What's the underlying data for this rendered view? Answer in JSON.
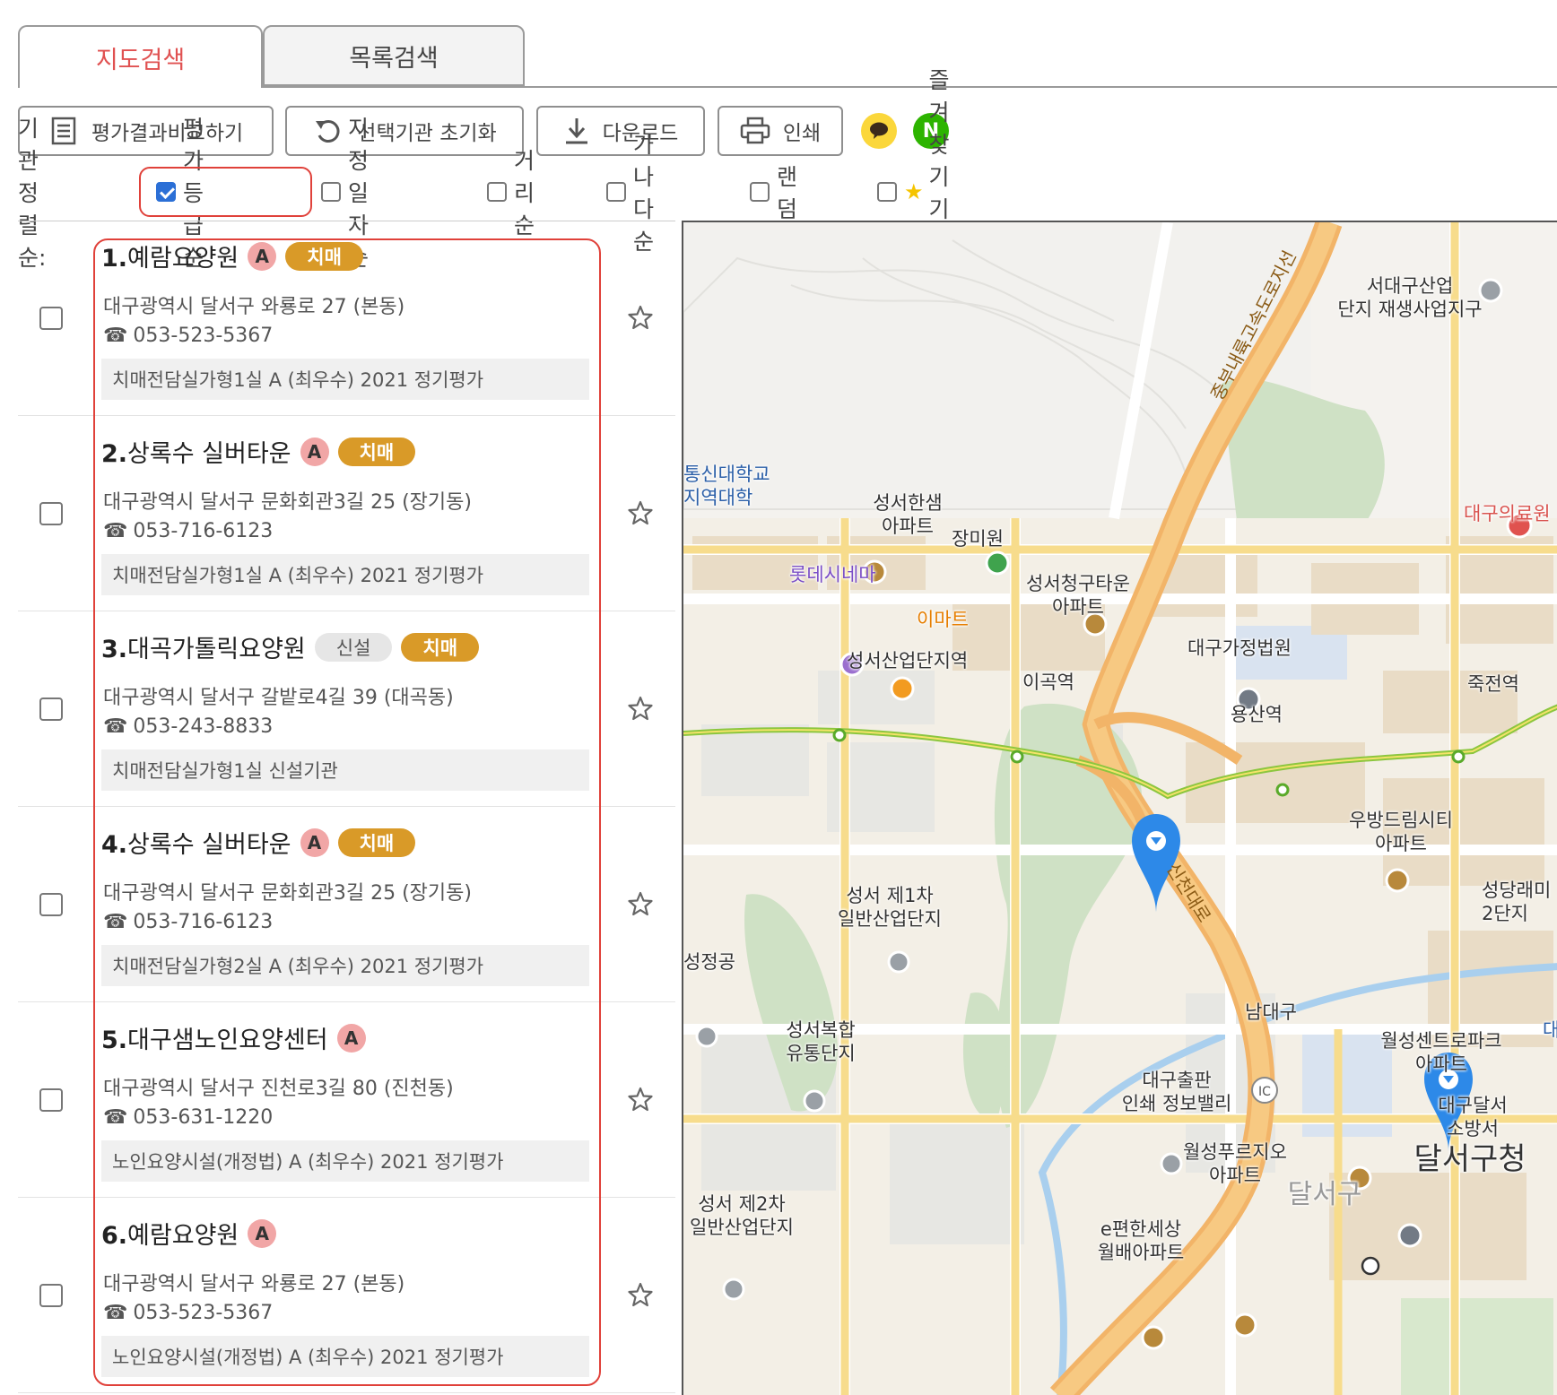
{
  "tabs": [
    {
      "label": "지도검색",
      "active": true
    },
    {
      "label": "목록검색",
      "active": false
    }
  ],
  "toolbar": {
    "compare": "평가결과비교하기",
    "reset": "선택기관 초기화",
    "download": "다운로드",
    "print": "인쇄",
    "share_kakao_icon": "kakao-talk-icon",
    "share_naver_icon": "naver-icon",
    "naver_letter": "N"
  },
  "sort": {
    "label": "기관정렬순:",
    "options": [
      {
        "label": "평가등급순",
        "checked": true
      },
      {
        "label": "지정일자순",
        "checked": false
      },
      {
        "label": "거리순",
        "checked": false
      },
      {
        "label": "가나다순",
        "checked": false
      },
      {
        "label": "랜덤",
        "checked": false
      }
    ],
    "favorites": "즐겨찾기 기관 보기"
  },
  "list": [
    {
      "num": "1.",
      "name": "예람요양원",
      "grade": "A",
      "new_badge": null,
      "dementia_badge": "치매",
      "address": "대구광역시 달서구 와룡로 27 (본동)",
      "phone": "053-523-5367",
      "eval": "치매전담실가형1실 A (최우수) 2021 정기평가"
    },
    {
      "num": "2.",
      "name": "상록수 실버타운",
      "grade": "A",
      "new_badge": null,
      "dementia_badge": "치매",
      "address": "대구광역시 달서구 문화회관3길 25 (장기동)",
      "phone": "053-716-6123",
      "eval": "치매전담실가형1실 A (최우수) 2021 정기평가"
    },
    {
      "num": "3.",
      "name": "대곡가톨릭요양원",
      "grade": null,
      "new_badge": "신설",
      "dementia_badge": "치매",
      "address": "대구광역시 달서구 갈밭로4길 39 (대곡동)",
      "phone": "053-243-8833",
      "eval": "치매전담실가형1실 신설기관"
    },
    {
      "num": "4.",
      "name": "상록수 실버타운",
      "grade": "A",
      "new_badge": null,
      "dementia_badge": "치매",
      "address": "대구광역시 달서구 문화회관3길 25 (장기동)",
      "phone": "053-716-6123",
      "eval": "치매전담실가형2실 A (최우수) 2021 정기평가"
    },
    {
      "num": "5.",
      "name": "대구샘노인요양센터",
      "grade": "A",
      "new_badge": null,
      "dementia_badge": null,
      "address": "대구광역시 달서구 진천로3길 80 (진천동)",
      "phone": "053-631-1220",
      "eval": "노인요양시설(개정법) A (최우수) 2021 정기평가"
    },
    {
      "num": "6.",
      "name": "예람요양원",
      "grade": "A",
      "new_badge": null,
      "dementia_badge": null,
      "address": "대구광역시 달서구 와룡로 27 (본동)",
      "phone": "053-523-5367",
      "eval": "노인요양시설(개정법) A (최우수) 2021 정기평가"
    }
  ],
  "map": {
    "road_label_1": "중부내륙고속도로지선",
    "road_label_2": "신천대로",
    "ic_label": "IC",
    "labels": [
      {
        "text": "서대구산업\n단지 재생사업지구"
      },
      {
        "text": "통신대학교\n지역대학"
      },
      {
        "text": "대구의료원"
      },
      {
        "text": "성서한샘\n아파트"
      },
      {
        "text": "장미원"
      },
      {
        "text": "성서청구타운\n아파트"
      },
      {
        "text": "롯데시네마"
      },
      {
        "text": "이마트"
      },
      {
        "text": "대구가정법원"
      },
      {
        "text": "성서산업단지역"
      },
      {
        "text": "이곡역"
      },
      {
        "text": "용산역"
      },
      {
        "text": "죽전역"
      },
      {
        "text": "우방드림시티\n아파트"
      },
      {
        "text": "성서 제1차\n일반산업단지"
      },
      {
        "text": "성당래미\n2단지"
      },
      {
        "text": "성정공"
      },
      {
        "text": "남대구"
      },
      {
        "text": "성서복합\n유통단지"
      },
      {
        "text": "월성센트로파크\n아파트"
      },
      {
        "text": "대"
      },
      {
        "text": "대구출판\n인쇄 정보밸리"
      },
      {
        "text": "대구달서\n소방서"
      },
      {
        "text": "월성푸르지오\n아파트"
      },
      {
        "text": "달서구청"
      },
      {
        "text": "달서구"
      },
      {
        "text": "성서 제2차\n일반산업단지"
      },
      {
        "text": "e편한세상\n월배아파트"
      }
    ]
  },
  "colors": {
    "active_tab": "#e05151",
    "highlight_border": "#e0413a",
    "dementia_badge": "#d99a28",
    "grade_badge": "#f1a6a6",
    "checkbox_checked": "#2b6fd6",
    "map_marker": "#2d89e8"
  }
}
